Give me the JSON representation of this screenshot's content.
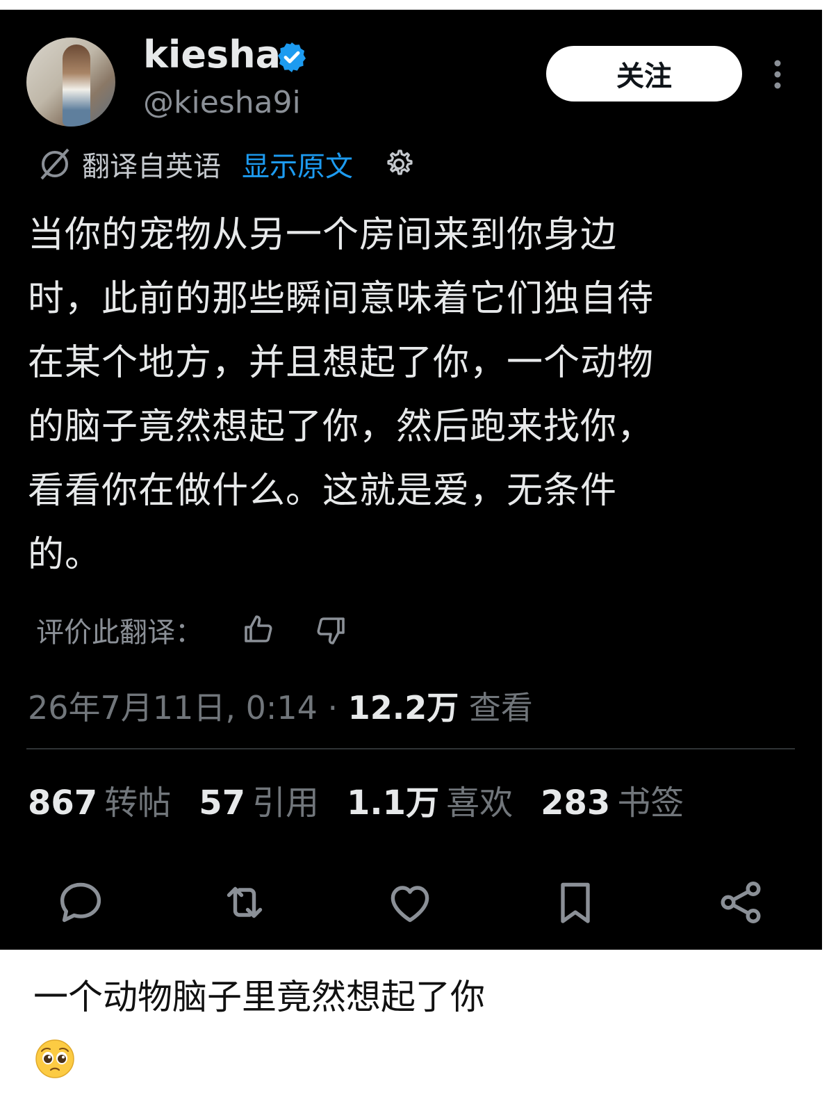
{
  "post": {
    "display_name": "kiesha",
    "handle": "@kiesha9i",
    "follow_label": "关注",
    "translation": {
      "label": "翻译自英语",
      "show_original": "显示原文"
    },
    "text": "当你的宠物从另一个房间来到你身边\n时，此前的那些瞬间意味着它们独自待\n在某个地方，并且想起了你，一个动物\n的脑子竟然想起了你，然后跑来找你，\n看看你在做什么。这就是爱，无条件\n的。",
    "rate_label": "评价此翻译：",
    "timestamp": "26年7月11日, 0:14 · ",
    "views_count": "12.2万",
    "views_label": " 查看",
    "stats": {
      "reposts": {
        "count": "867",
        "label": "转帖"
      },
      "quotes": {
        "count": "57",
        "label": "引用"
      },
      "likes": {
        "count": "1.1万",
        "label": "喜欢"
      },
      "bookmarks": {
        "count": "283",
        "label": "书签"
      }
    },
    "icons": [
      "verified-badge-icon",
      "more-icon",
      "translate-icon",
      "gear-icon",
      "thumbs-up-icon",
      "thumbs-down-icon",
      "reply-icon",
      "repost-icon",
      "like-icon",
      "bookmark-icon",
      "share-icon"
    ],
    "colors": {
      "background": "#000000",
      "accent": "#1d9bf0",
      "text": "#e7e9ea",
      "muted": "#71767b"
    }
  },
  "caption": {
    "text": "一个动物脑子里竟然想起了你",
    "emoji": "pleading-face-emoji"
  }
}
